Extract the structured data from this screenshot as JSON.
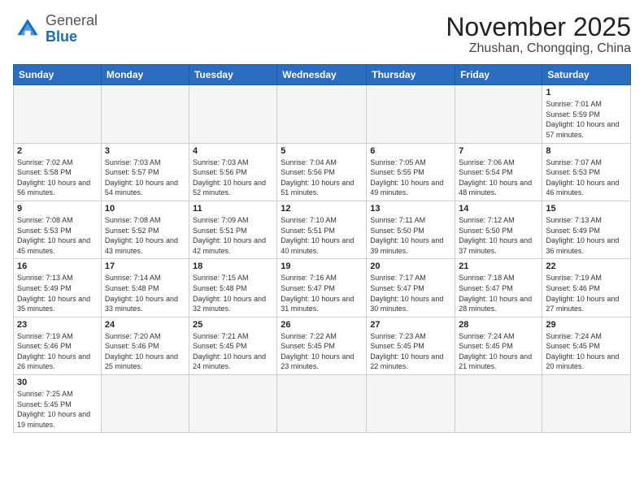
{
  "logo": {
    "general": "General",
    "blue": "Blue"
  },
  "title": {
    "month_year": "November 2025",
    "location": "Zhushan, Chongqing, China"
  },
  "weekdays": [
    "Sunday",
    "Monday",
    "Tuesday",
    "Wednesday",
    "Thursday",
    "Friday",
    "Saturday"
  ],
  "days": {
    "d1": {
      "num": "1",
      "sunrise": "7:01 AM",
      "sunset": "5:59 PM",
      "hours": "10",
      "mins": "57"
    },
    "d2": {
      "num": "2",
      "sunrise": "7:02 AM",
      "sunset": "5:58 PM",
      "hours": "10",
      "mins": "56"
    },
    "d3": {
      "num": "3",
      "sunrise": "7:03 AM",
      "sunset": "5:57 PM",
      "hours": "10",
      "mins": "54"
    },
    "d4": {
      "num": "4",
      "sunrise": "7:03 AM",
      "sunset": "5:56 PM",
      "hours": "10",
      "mins": "52"
    },
    "d5": {
      "num": "5",
      "sunrise": "7:04 AM",
      "sunset": "5:56 PM",
      "hours": "10",
      "mins": "51"
    },
    "d6": {
      "num": "6",
      "sunrise": "7:05 AM",
      "sunset": "5:55 PM",
      "hours": "10",
      "mins": "49"
    },
    "d7": {
      "num": "7",
      "sunrise": "7:06 AM",
      "sunset": "5:54 PM",
      "hours": "10",
      "mins": "48"
    },
    "d8": {
      "num": "8",
      "sunrise": "7:07 AM",
      "sunset": "5:53 PM",
      "hours": "10",
      "mins": "46"
    },
    "d9": {
      "num": "9",
      "sunrise": "7:08 AM",
      "sunset": "5:53 PM",
      "hours": "10",
      "mins": "45"
    },
    "d10": {
      "num": "10",
      "sunrise": "7:08 AM",
      "sunset": "5:52 PM",
      "hours": "10",
      "mins": "43"
    },
    "d11": {
      "num": "11",
      "sunrise": "7:09 AM",
      "sunset": "5:51 PM",
      "hours": "10",
      "mins": "42"
    },
    "d12": {
      "num": "12",
      "sunrise": "7:10 AM",
      "sunset": "5:51 PM",
      "hours": "10",
      "mins": "40"
    },
    "d13": {
      "num": "13",
      "sunrise": "7:11 AM",
      "sunset": "5:50 PM",
      "hours": "10",
      "mins": "39"
    },
    "d14": {
      "num": "14",
      "sunrise": "7:12 AM",
      "sunset": "5:50 PM",
      "hours": "10",
      "mins": "37"
    },
    "d15": {
      "num": "15",
      "sunrise": "7:13 AM",
      "sunset": "5:49 PM",
      "hours": "10",
      "mins": "36"
    },
    "d16": {
      "num": "16",
      "sunrise": "7:13 AM",
      "sunset": "5:49 PM",
      "hours": "10",
      "mins": "35"
    },
    "d17": {
      "num": "17",
      "sunrise": "7:14 AM",
      "sunset": "5:48 PM",
      "hours": "10",
      "mins": "33"
    },
    "d18": {
      "num": "18",
      "sunrise": "7:15 AM",
      "sunset": "5:48 PM",
      "hours": "10",
      "mins": "32"
    },
    "d19": {
      "num": "19",
      "sunrise": "7:16 AM",
      "sunset": "5:47 PM",
      "hours": "10",
      "mins": "31"
    },
    "d20": {
      "num": "20",
      "sunrise": "7:17 AM",
      "sunset": "5:47 PM",
      "hours": "10",
      "mins": "30"
    },
    "d21": {
      "num": "21",
      "sunrise": "7:18 AM",
      "sunset": "5:47 PM",
      "hours": "10",
      "mins": "28"
    },
    "d22": {
      "num": "22",
      "sunrise": "7:19 AM",
      "sunset": "5:46 PM",
      "hours": "10",
      "mins": "27"
    },
    "d23": {
      "num": "23",
      "sunrise": "7:19 AM",
      "sunset": "5:46 PM",
      "hours": "10",
      "mins": "26"
    },
    "d24": {
      "num": "24",
      "sunrise": "7:20 AM",
      "sunset": "5:46 PM",
      "hours": "10",
      "mins": "25"
    },
    "d25": {
      "num": "25",
      "sunrise": "7:21 AM",
      "sunset": "5:45 PM",
      "hours": "10",
      "mins": "24"
    },
    "d26": {
      "num": "26",
      "sunrise": "7:22 AM",
      "sunset": "5:45 PM",
      "hours": "10",
      "mins": "23"
    },
    "d27": {
      "num": "27",
      "sunrise": "7:23 AM",
      "sunset": "5:45 PM",
      "hours": "10",
      "mins": "22"
    },
    "d28": {
      "num": "28",
      "sunrise": "7:24 AM",
      "sunset": "5:45 PM",
      "hours": "10",
      "mins": "21"
    },
    "d29": {
      "num": "29",
      "sunrise": "7:24 AM",
      "sunset": "5:45 PM",
      "hours": "10",
      "mins": "20"
    },
    "d30": {
      "num": "30",
      "sunrise": "7:25 AM",
      "sunset": "5:45 PM",
      "hours": "10",
      "mins": "19"
    }
  },
  "labels": {
    "sunrise": "Sunrise:",
    "sunset": "Sunset:",
    "daylight": "Daylight:",
    "hours_and": "hours and",
    "minutes": "minutes."
  }
}
